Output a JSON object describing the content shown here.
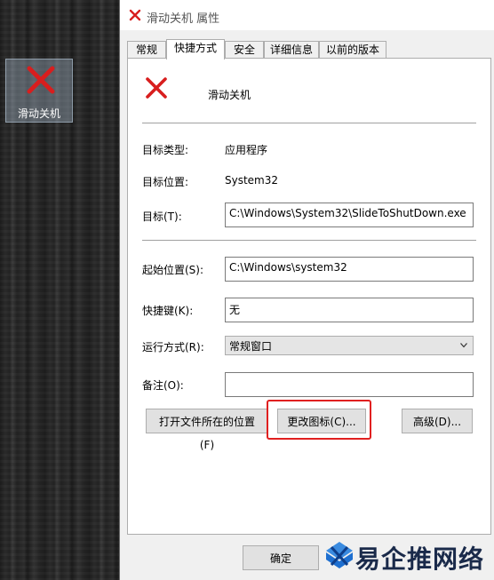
{
  "desktop": {
    "icon_label": "滑动关机"
  },
  "window": {
    "title": "滑动关机 属性",
    "tabs": [
      {
        "label": "常规"
      },
      {
        "label": "快捷方式"
      },
      {
        "label": "安全"
      },
      {
        "label": "详细信息"
      },
      {
        "label": "以前的版本"
      }
    ],
    "active_tab": "快捷方式",
    "shortcut": {
      "name": "滑动关机",
      "target_type_label": "目标类型:",
      "target_type_value": "应用程序",
      "target_location_label": "目标位置:",
      "target_location_value": "System32",
      "target_label": "目标(T):",
      "target_value": "C:\\Windows\\System32\\SlideToShutDown.exe",
      "start_in_label": "起始位置(S):",
      "start_in_value": "C:\\Windows\\system32",
      "hotkey_label": "快捷键(K):",
      "hotkey_value": "无",
      "run_label": "运行方式(R):",
      "run_value": "常规窗口",
      "comment_label": "备注(O):",
      "comment_value": "",
      "open_location_button": "打开文件所在的位置(F)",
      "change_icon_button": "更改图标(C)...",
      "advanced_button": "高级(D)..."
    },
    "ok_button": "确定"
  },
  "watermark": {
    "text": "易企推网络"
  },
  "colors": {
    "red_x": "#d81e1e",
    "highlight_box": "#e02020",
    "watermark_blue": "#1e6fd0"
  }
}
